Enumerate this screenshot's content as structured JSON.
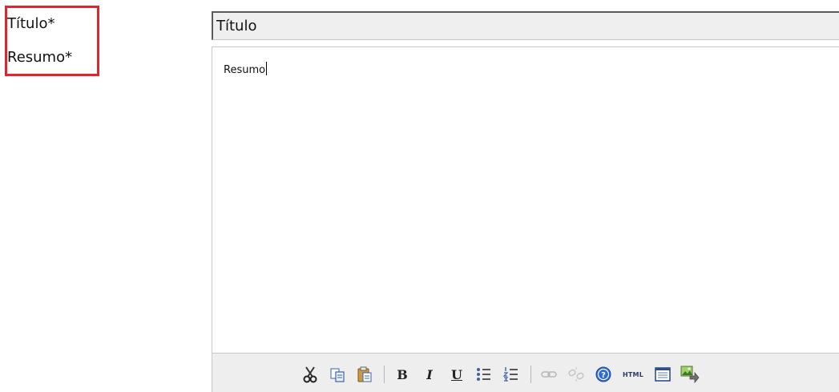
{
  "labels": {
    "titulo": "Título*",
    "resumo": "Resumo*"
  },
  "title_input": {
    "value": "Título"
  },
  "editor": {
    "content": "Resumo"
  },
  "toolbar": {
    "html_label": "HTML",
    "bold_glyph": "B",
    "italic_glyph": "I",
    "underline_glyph": "U",
    "icons": [
      "cut-icon",
      "copy-icon",
      "paste-icon",
      "bold-icon",
      "italic-icon",
      "underline-icon",
      "bullet-list-icon",
      "numbered-list-icon",
      "link-icon",
      "unlink-icon",
      "help-icon",
      "html-source-icon",
      "fullscreen-icon",
      "insert-image-icon"
    ]
  },
  "colors": {
    "highlight_border": "#e0262d",
    "input_background": "#efefef",
    "toolbar_background": "#eeeeee"
  }
}
